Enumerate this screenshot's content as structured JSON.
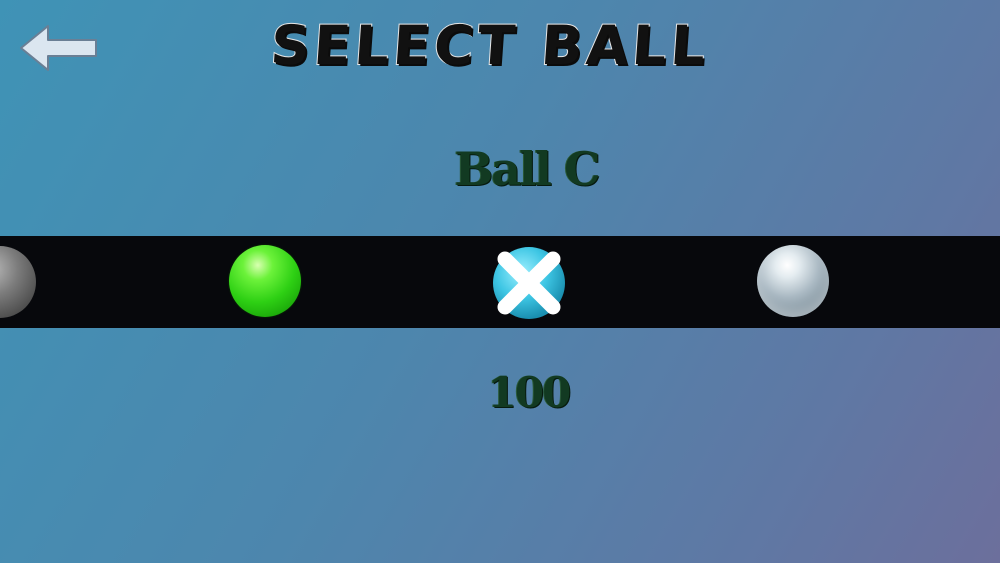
{
  "screen": {
    "title": "SELECT BALL",
    "back_icon": "arrow-left-icon"
  },
  "selection": {
    "ball_name": "Ball C",
    "price": "100"
  },
  "carousel": {
    "balls": [
      {
        "name": "gray-ball",
        "color": "#7c7c7c",
        "partially_visible": true
      },
      {
        "name": "green-ball",
        "color": "#2ed014"
      },
      {
        "name": "cross-ball",
        "color": "#3ec6e4",
        "icon": "x-cross-icon",
        "selected": true
      },
      {
        "name": "glass-ball",
        "color": "#a9b8c2"
      }
    ]
  },
  "colors": {
    "strip": "#07080c",
    "text_green": "#123a22",
    "back_arrow": "#dbe6f0"
  }
}
